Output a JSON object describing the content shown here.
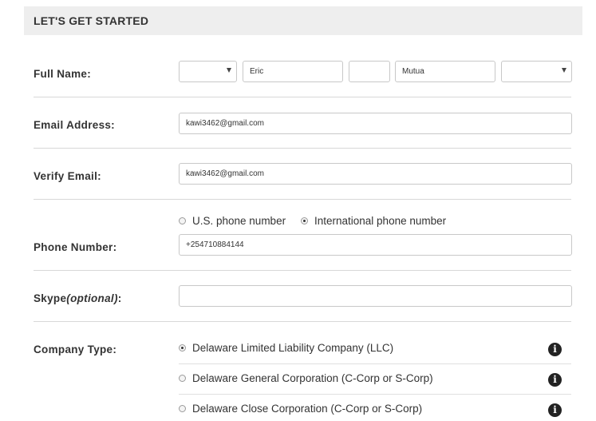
{
  "header": {
    "title": "LET'S GET STARTED"
  },
  "labels": {
    "full_name": "Full Name:",
    "email": "Email Address:",
    "verify_email": "Verify Email:",
    "phone": "Phone Number:",
    "skype": "Skype",
    "skype_optional": "(optional)",
    "skype_colon": ":",
    "company_type": "Company Type:"
  },
  "full_name": {
    "prefix": "",
    "first": "Eric",
    "middle": "",
    "last": "Mutua",
    "suffix": ""
  },
  "email": {
    "value": "kawi3462@gmail.com"
  },
  "verify_email": {
    "value": "kawi3462@gmail.com"
  },
  "phone": {
    "options": [
      {
        "label": "U.S. phone number",
        "checked": false
      },
      {
        "label": "International phone number",
        "checked": true
      }
    ],
    "value": "+254710884144"
  },
  "skype": {
    "value": ""
  },
  "company_types": [
    {
      "label": "Delaware Limited Liability Company (LLC)",
      "checked": true
    },
    {
      "label": "Delaware General Corporation (C-Corp or S-Corp)",
      "checked": false
    },
    {
      "label": "Delaware Close Corporation (C-Corp or S-Corp)",
      "checked": false
    }
  ],
  "info_icon_glyph": "i"
}
